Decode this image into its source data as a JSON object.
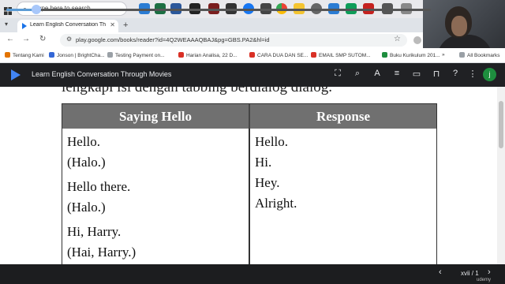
{
  "taskbar": {
    "search_placeholder": "Type here to search",
    "icons": [
      "windows-icon",
      "edge-icon",
      "excel-icon",
      "word-icon",
      "media-icon",
      "messenger-icon",
      "chrome-icon",
      "explorer-icon",
      "settings-icon"
    ]
  },
  "browser": {
    "tab_title": "Learn English Conversation Thr",
    "url": "play.google.com/books/reader?id=4Q2WEAAAQBAJ&pg=GBS.PA2&hl=id",
    "bookmarks": [
      {
        "label": "Tentang Kami",
        "color": "#e37400"
      },
      {
        "label": "Jonson | BrightCha...",
        "color": "#3367d6"
      },
      {
        "label": "Testing Payment on...",
        "color": "#9aa0a6"
      },
      {
        "label": "Harian Analisa, 22 D...",
        "color": "#d93025"
      },
      {
        "label": "CARA DUA DAN SE...",
        "color": "#d93025"
      },
      {
        "label": "EMAIL SMP SUTOM...",
        "color": "#d93025"
      },
      {
        "label": "Buku Kurikulum 201...",
        "color": "#1e8e3e"
      }
    ],
    "all_bookmarks": "All Bookmarks"
  },
  "reader": {
    "title": "Learn English Conversation Through Movies",
    "avatar_letter": "j",
    "cut_line": "lengkapi isi dengan tabbing berdialog dialog.",
    "table": {
      "headers": [
        "Saying Hello",
        "Response"
      ],
      "left": [
        "Hello.",
        "(Halo.)",
        "Hello there.",
        "(Halo.)",
        "Hi, Harry.",
        "(Hai, Harry.)"
      ],
      "right": [
        "Hello.",
        "Hi.",
        "Hey.",
        "Alright."
      ]
    }
  },
  "player": {
    "progress": 0.07,
    "page_indicator": "xvii / 1",
    "watermark": "udemy"
  },
  "colors": {
    "reader_header": "#202124",
    "table_header": "#707070",
    "accent": "#5b9bd5"
  }
}
